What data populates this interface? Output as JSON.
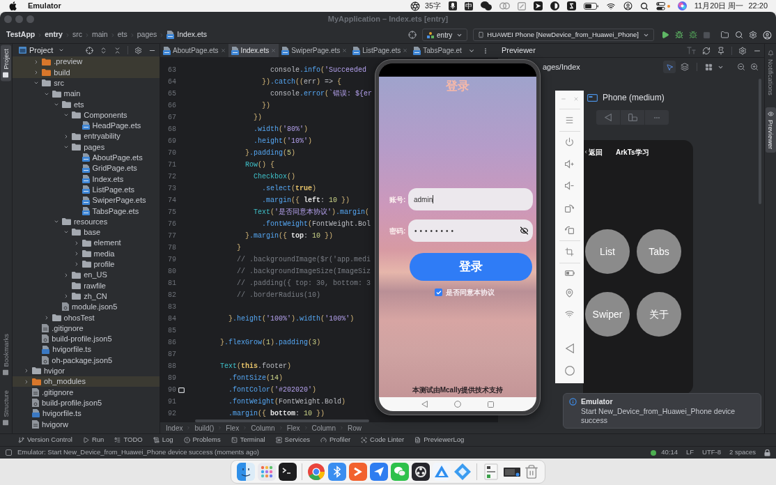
{
  "menu_bar": {
    "app_name": "Emulator",
    "word_count": "35字",
    "input_method": "中",
    "date": "11月20日 周一",
    "time": "22:20"
  },
  "window": {
    "title": "MyApplication – Index.ets [entry]"
  },
  "navigation_bar": {
    "breadcrumb": [
      {
        "label": "TestApp",
        "kind": "module"
      },
      {
        "label": "entry",
        "kind": "module"
      },
      {
        "label": "src",
        "kind": "folder"
      },
      {
        "label": "main",
        "kind": "folder"
      },
      {
        "label": "ets",
        "kind": "folder"
      },
      {
        "label": "pages",
        "kind": "folder"
      },
      {
        "label": "Index.ets",
        "kind": "file"
      }
    ],
    "module_selector": "entry",
    "device_selector": "HUAWEI Phone [NewDevice_from_Huawei_Phone]"
  },
  "left_toolbar": {
    "top": [
      {
        "label": "Project",
        "selected": true
      }
    ],
    "bottom": [
      {
        "label": "Bookmarks",
        "selected": false
      },
      {
        "label": "Structure",
        "selected": false
      }
    ]
  },
  "project_panel": {
    "title": "Project",
    "tree": [
      {
        "children": [
          {
            "label": ".preview",
            "kind": "folder",
            "expanded": false,
            "excluded": true
          },
          {
            "label": "build",
            "kind": "folder",
            "expanded": false,
            "excluded": true
          },
          {
            "label": "src",
            "kind": "folder",
            "expanded": true,
            "excluded": false,
            "children": [
              {
                "label": "main",
                "kind": "folder",
                "expanded": true,
                "excluded": false,
                "children": [
                  {
                    "label": "ets",
                    "kind": "folder",
                    "expanded": true,
                    "excluded": false,
                    "children": [
                      {
                        "label": "Components",
                        "kind": "folder",
                        "expanded": true,
                        "excluded": false,
                        "children": [
                          {
                            "label": "HeadPage.ets",
                            "kind": "ets"
                          }
                        ]
                      },
                      {
                        "label": "entryability",
                        "kind": "folder",
                        "expanded": false,
                        "excluded": false
                      },
                      {
                        "label": "pages",
                        "kind": "folder",
                        "expanded": true,
                        "excluded": false,
                        "children": [
                          {
                            "label": "AboutPage.ets",
                            "kind": "ets"
                          },
                          {
                            "label": "GridPage.ets",
                            "kind": "ets"
                          },
                          {
                            "label": "Index.ets",
                            "kind": "ets"
                          },
                          {
                            "label": "ListPage.ets",
                            "kind": "ets"
                          },
                          {
                            "label": "SwiperPage.ets",
                            "kind": "ets"
                          },
                          {
                            "label": "TabsPage.ets",
                            "kind": "ets"
                          }
                        ]
                      }
                    ]
                  },
                  {
                    "label": "resources",
                    "kind": "folder",
                    "expanded": true,
                    "excluded": false,
                    "children": [
                      {
                        "label": "base",
                        "kind": "folder",
                        "expanded": true,
                        "excluded": false,
                        "children": [
                          {
                            "label": "element",
                            "kind": "folder",
                            "expanded": false,
                            "excluded": false
                          },
                          {
                            "label": "media",
                            "kind": "folder",
                            "expanded": false,
                            "excluded": false
                          },
                          {
                            "label": "profile",
                            "kind": "folder",
                            "expanded": false,
                            "excluded": false
                          }
                        ]
                      },
                      {
                        "label": "en_US",
                        "kind": "folder",
                        "expanded": false,
                        "excluded": false
                      },
                      {
                        "label": "rawfile",
                        "kind": "folder",
                        "excluded": false
                      },
                      {
                        "label": "zh_CN",
                        "kind": "folder",
                        "expanded": false,
                        "excluded": false
                      }
                    ]
                  },
                  {
                    "label": "module.json5",
                    "kind": "json"
                  }
                ]
              },
              {
                "label": "ohosTest",
                "kind": "folder",
                "expanded": false,
                "excluded": false
              }
            ]
          },
          {
            "label": ".gitignore",
            "kind": "text"
          },
          {
            "label": "build-profile.json5",
            "kind": "json"
          },
          {
            "label": "hvigorfile.ts",
            "kind": "ts"
          },
          {
            "label": "oh-package.json5",
            "kind": "json"
          }
        ]
      },
      {
        "label": "hvigor",
        "kind": "folder",
        "expanded": false,
        "excluded": false
      },
      {
        "label": "oh_modules",
        "kind": "folder",
        "expanded": false,
        "excluded": true
      },
      {
        "label": ".gitignore",
        "kind": "text"
      },
      {
        "label": "build-profile.json5",
        "kind": "json"
      },
      {
        "label": "hvigorfile.ts",
        "kind": "ts"
      },
      {
        "label": "hvigorw",
        "kind": "text"
      }
    ]
  },
  "editor": {
    "tabs": [
      {
        "label": "AboutPage.ets",
        "selected": false,
        "close_button": true
      },
      {
        "label": "Index.ets",
        "selected": true,
        "close_button": true
      },
      {
        "label": "SwiperPage.ets",
        "selected": false,
        "close_button": true
      },
      {
        "label": "ListPage.ets",
        "selected": false,
        "close_button": true
      },
      {
        "label": "TabsPage.et",
        "selected": false,
        "close_button": false
      }
    ],
    "lines": [
      {
        "number": "63",
        "marked": false,
        "tokens": [
          {
            "text": "                console",
            "kind": "plain"
          },
          {
            "text": ".info",
            "kind": "method"
          },
          {
            "text": "(",
            "kind": "punct"
          },
          {
            "text": "'Succeeded",
            "kind": "string"
          }
        ]
      },
      {
        "number": "64",
        "marked": false,
        "tokens": [
          {
            "text": "              })",
            "kind": "punct"
          },
          {
            "text": ".catch",
            "kind": "method"
          },
          {
            "text": "((",
            "kind": "punct"
          },
          {
            "text": "err",
            "kind": "plain"
          },
          {
            "text": ")",
            "kind": "punct"
          },
          {
            "text": " => ",
            "kind": "plain"
          },
          {
            "text": "{",
            "kind": "punct"
          }
        ]
      },
      {
        "number": "65",
        "marked": false,
        "tokens": [
          {
            "text": "                console",
            "kind": "plain"
          },
          {
            "text": ".error",
            "kind": "method"
          },
          {
            "text": "(",
            "kind": "punct"
          },
          {
            "text": "`错误: ${er",
            "kind": "string"
          }
        ]
      },
      {
        "number": "66",
        "marked": false,
        "tokens": [
          {
            "text": "              })",
            "kind": "punct"
          }
        ]
      },
      {
        "number": "67",
        "marked": false,
        "tokens": [
          {
            "text": "            })",
            "kind": "punct"
          }
        ]
      },
      {
        "number": "68",
        "marked": false,
        "tokens": [
          {
            "text": "            .width",
            "kind": "method"
          },
          {
            "text": "(",
            "kind": "punct"
          },
          {
            "text": "'80%'",
            "kind": "string"
          },
          {
            "text": ")",
            "kind": "punct"
          }
        ]
      },
      {
        "number": "69",
        "marked": false,
        "tokens": [
          {
            "text": "            .height",
            "kind": "method"
          },
          {
            "text": "(",
            "kind": "punct"
          },
          {
            "text": "'10%'",
            "kind": "string"
          },
          {
            "text": ")",
            "kind": "punct"
          }
        ]
      },
      {
        "number": "70",
        "marked": false,
        "tokens": [
          {
            "text": "          }",
            "kind": "punct"
          },
          {
            "text": ".padding",
            "kind": "method"
          },
          {
            "text": "(",
            "kind": "punct"
          },
          {
            "text": "5",
            "kind": "number"
          },
          {
            "text": ")",
            "kind": "punct"
          }
        ]
      },
      {
        "number": "71",
        "marked": false,
        "tokens": [
          {
            "text": "          Row",
            "kind": "component"
          },
          {
            "text": "() {",
            "kind": "punct"
          }
        ]
      },
      {
        "number": "72",
        "marked": false,
        "tokens": [
          {
            "text": "            Checkbox",
            "kind": "component"
          },
          {
            "text": "()",
            "kind": "punct"
          }
        ]
      },
      {
        "number": "73",
        "marked": false,
        "tokens": [
          {
            "text": "              .select",
            "kind": "method"
          },
          {
            "text": "(",
            "kind": "punct"
          },
          {
            "text": "true",
            "kind": "keyword"
          },
          {
            "text": ")",
            "kind": "punct"
          }
        ]
      },
      {
        "number": "74",
        "marked": false,
        "tokens": [
          {
            "text": "              .margin",
            "kind": "method"
          },
          {
            "text": "({ ",
            "kind": "punct"
          },
          {
            "text": "left",
            "kind": "property"
          },
          {
            "text": ": ",
            "kind": "plain"
          },
          {
            "text": "10",
            "kind": "number"
          },
          {
            "text": " })",
            "kind": "punct"
          }
        ]
      },
      {
        "number": "75",
        "marked": false,
        "tokens": [
          {
            "text": "            Text",
            "kind": "component"
          },
          {
            "text": "(",
            "kind": "punct"
          },
          {
            "text": "'是否同意本协议'",
            "kind": "string"
          },
          {
            "text": ")",
            "kind": "punct"
          },
          {
            "text": ".margin",
            "kind": "method"
          },
          {
            "text": "(",
            "kind": "punct"
          }
        ]
      },
      {
        "number": "76",
        "marked": false,
        "tokens": [
          {
            "text": "              .fontWeight",
            "kind": "method"
          },
          {
            "text": "(",
            "kind": "punct"
          },
          {
            "text": "FontWeight.Bol",
            "kind": "plain"
          }
        ]
      },
      {
        "number": "77",
        "marked": false,
        "tokens": [
          {
            "text": "          }",
            "kind": "punct"
          },
          {
            "text": ".margin",
            "kind": "method"
          },
          {
            "text": "({ ",
            "kind": "punct"
          },
          {
            "text": "top",
            "kind": "property"
          },
          {
            "text": ": ",
            "kind": "plain"
          },
          {
            "text": "10",
            "kind": "number"
          },
          {
            "text": " })",
            "kind": "punct"
          }
        ]
      },
      {
        "number": "78",
        "marked": false,
        "tokens": [
          {
            "text": "        }",
            "kind": "punct"
          }
        ]
      },
      {
        "number": "79",
        "marked": false,
        "tokens": [
          {
            "text": "        // .backgroundImage($r('app.medi",
            "kind": "comment"
          }
        ]
      },
      {
        "number": "80",
        "marked": false,
        "tokens": [
          {
            "text": "        // .backgroundImageSize(ImageSiz",
            "kind": "comment"
          }
        ]
      },
      {
        "number": "81",
        "marked": false,
        "tokens": [
          {
            "text": "        // .padding({ top: 30, bottom: 3",
            "kind": "comment"
          }
        ]
      },
      {
        "number": "82",
        "marked": false,
        "tokens": [
          {
            "text": "        // .borderRadius(10)",
            "kind": "comment"
          }
        ]
      },
      {
        "number": "83",
        "marked": false
      },
      {
        "number": "84",
        "marked": false,
        "tokens": [
          {
            "text": "      }",
            "kind": "punct"
          },
          {
            "text": ".height",
            "kind": "method"
          },
          {
            "text": "(",
            "kind": "punct"
          },
          {
            "text": "'100%'",
            "kind": "string"
          },
          {
            "text": ")",
            "kind": "punct"
          },
          {
            "text": ".width",
            "kind": "method"
          },
          {
            "text": "(",
            "kind": "punct"
          },
          {
            "text": "'100%'",
            "kind": "string"
          },
          {
            "text": ")",
            "kind": "punct"
          }
        ]
      },
      {
        "number": "85",
        "marked": false
      },
      {
        "number": "86",
        "marked": false,
        "tokens": [
          {
            "text": "    }",
            "kind": "punct"
          },
          {
            "text": ".flexGrow",
            "kind": "method"
          },
          {
            "text": "(",
            "kind": "punct"
          },
          {
            "text": "1",
            "kind": "number"
          },
          {
            "text": ")",
            "kind": "punct"
          },
          {
            "text": ".padding",
            "kind": "method"
          },
          {
            "text": "(",
            "kind": "punct"
          },
          {
            "text": "3",
            "kind": "number"
          },
          {
            "text": ")",
            "kind": "punct"
          }
        ]
      },
      {
        "number": "87",
        "marked": false
      },
      {
        "number": "88",
        "marked": false,
        "tokens": [
          {
            "text": "    Text",
            "kind": "component"
          },
          {
            "text": "(",
            "kind": "punct"
          },
          {
            "text": "this",
            "kind": "keyword"
          },
          {
            "text": ".footer",
            "kind": "plain"
          },
          {
            "text": ")",
            "kind": "punct"
          }
        ]
      },
      {
        "number": "89",
        "marked": false,
        "tokens": [
          {
            "text": "      .fontSize",
            "kind": "method"
          },
          {
            "text": "(",
            "kind": "punct"
          },
          {
            "text": "14",
            "kind": "number"
          },
          {
            "text": ")",
            "kind": "punct"
          }
        ]
      },
      {
        "number": "90",
        "marked": true,
        "tokens": [
          {
            "text": "      .fontColor",
            "kind": "method"
          },
          {
            "text": "(",
            "kind": "punct"
          },
          {
            "text": "'#202020'",
            "kind": "string"
          },
          {
            "text": ")",
            "kind": "punct"
          }
        ]
      },
      {
        "number": "91",
        "marked": false,
        "tokens": [
          {
            "text": "      .fontWeight",
            "kind": "method"
          },
          {
            "text": "(",
            "kind": "punct"
          },
          {
            "text": "FontWeight.Bold",
            "kind": "plain"
          },
          {
            "text": ")",
            "kind": "punct"
          }
        ]
      },
      {
        "number": "92",
        "marked": false,
        "tokens": [
          {
            "text": "      .margin",
            "kind": "method"
          },
          {
            "text": "({ ",
            "kind": "punct"
          },
          {
            "text": "bottom",
            "kind": "property"
          },
          {
            "text": ": ",
            "kind": "plain"
          },
          {
            "text": "10",
            "kind": "number"
          },
          {
            "text": " })",
            "kind": "punct"
          }
        ]
      }
    ],
    "breadcrumb": [
      "Index",
      "build()",
      "Flex",
      "Column",
      "Flex",
      "Column",
      "Row"
    ]
  },
  "previewer": {
    "title": "Previewer",
    "page_path": "ages/Index",
    "inspector_enabled": true,
    "device_name": "Phone (medium)",
    "app": {
      "back_label": "返回",
      "title": "ArkTs学习",
      "buttons": [
        "List",
        "Tabs",
        "Swiper",
        "关于"
      ]
    }
  },
  "right_toolbar": [
    {
      "label": "Notifications",
      "selected": false
    },
    {
      "label": "Previewer",
      "selected": true
    }
  ],
  "tool_windows": [
    "Version Control",
    "Run",
    "TODO",
    "Log",
    "Problems",
    "Terminal",
    "Services",
    "Profiler",
    "Code Linter",
    "PreviewerLog"
  ],
  "status_bar": {
    "message": "Emulator: Start New_Device_from_Huawei_Phone device success (moments ago)",
    "position": "40:14",
    "line_separator": "LF",
    "encoding": "UTF-8",
    "indent": "2 spaces"
  },
  "emulator": {
    "title": "登录",
    "account_label": "账号:",
    "account_value": "admin",
    "password_label": "密码:",
    "password_value": "••••••••",
    "login_button": "登录",
    "agree_checked": true,
    "agree_label": "是否同意本协议",
    "footer": "本测试由Mcally提供技术支持"
  },
  "notification": {
    "title": "Emulator",
    "message": "Start New_Device_from_Huawei_Phone device success"
  }
}
